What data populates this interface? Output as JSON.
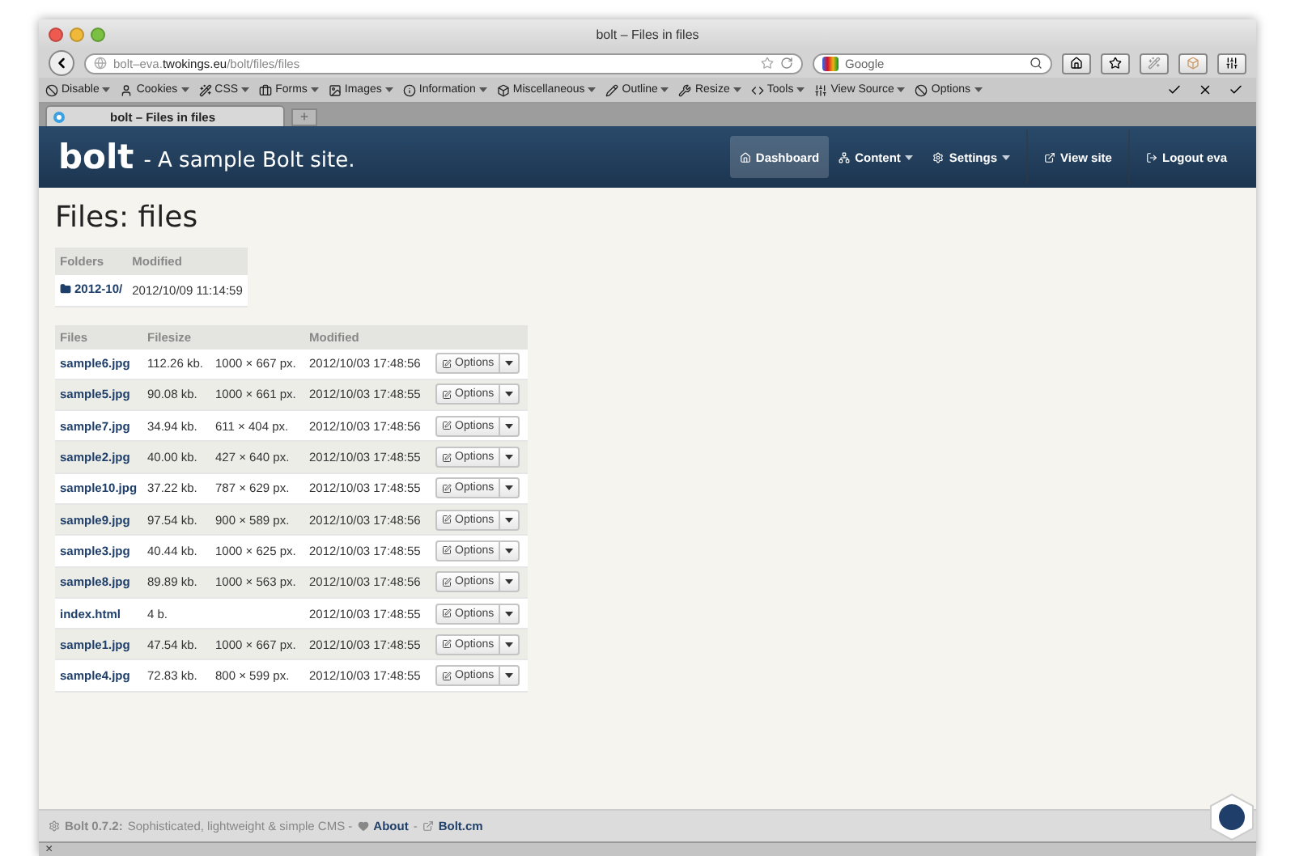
{
  "window": {
    "title": "bolt – Files in files"
  },
  "address_bar": {
    "url_prefix": "bolt–eva.",
    "url_domain": "twokings.eu",
    "url_path": "/bolt/files/files"
  },
  "search": {
    "engine": "Google"
  },
  "toolbar": [
    {
      "label": "Disable",
      "menu": true
    },
    {
      "label": "Cookies",
      "menu": true
    },
    {
      "label": "CSS",
      "menu": true
    },
    {
      "label": "Forms",
      "menu": true
    },
    {
      "label": "Images",
      "menu": true
    },
    {
      "label": "Information",
      "menu": true
    },
    {
      "label": "Miscellaneous",
      "menu": true
    },
    {
      "label": "Outline",
      "menu": true
    },
    {
      "label": "Resize",
      "menu": true
    },
    {
      "label": "Tools",
      "menu": true
    },
    {
      "label": "View Source",
      "menu": true
    },
    {
      "label": "Options",
      "menu": true
    }
  ],
  "tabs": [
    {
      "label": "bolt – Files in files",
      "selected": true
    }
  ],
  "new_tab": "+",
  "site": {
    "logo": "bolt",
    "tagline": "- A sample Bolt site."
  },
  "nav": [
    {
      "label": "Dashboard",
      "selected": true,
      "menu": false
    },
    {
      "label": "Content",
      "selected": false,
      "menu": true
    },
    {
      "label": "Settings",
      "selected": false,
      "menu": true
    },
    {
      "label": "View site",
      "selected": false,
      "menu": false
    },
    {
      "label": "Logout eva",
      "selected": false,
      "menu": false
    }
  ],
  "page_title": "Files: files",
  "folders": {
    "columns": [
      "Folders",
      "Modified"
    ],
    "rows": [
      {
        "name": "2012-10/",
        "modified": "2012/10/09 11:14:59"
      }
    ]
  },
  "files": {
    "columns": [
      "Files",
      "Filesize",
      "Modified"
    ],
    "rows": [
      {
        "name": "sample6.jpg",
        "size": "112.26 kb.",
        "dimensions": "1000 × 667 px.",
        "modified": "2012/10/03 17:48:56",
        "action": "Options"
      },
      {
        "name": "sample5.jpg",
        "size": "90.08 kb.",
        "dimensions": "1000 × 661 px.",
        "modified": "2012/10/03 17:48:55",
        "action": "Options"
      },
      {
        "name": "sample7.jpg",
        "size": "34.94 kb.",
        "dimensions": "611 × 404 px.",
        "modified": "2012/10/03 17:48:56",
        "action": "Options"
      },
      {
        "name": "sample2.jpg",
        "size": "40.00 kb.",
        "dimensions": "427 × 640 px.",
        "modified": "2012/10/03 17:48:55",
        "action": "Options"
      },
      {
        "name": "sample10.jpg",
        "size": "37.22 kb.",
        "dimensions": "787 × 629 px.",
        "modified": "2012/10/03 17:48:55",
        "action": "Options"
      },
      {
        "name": "sample9.jpg",
        "size": "97.54 kb.",
        "dimensions": "900 × 589 px.",
        "modified": "2012/10/03 17:48:56",
        "action": "Options"
      },
      {
        "name": "sample3.jpg",
        "size": "40.44 kb.",
        "dimensions": "1000 × 625 px.",
        "modified": "2012/10/03 17:48:55",
        "action": "Options"
      },
      {
        "name": "sample8.jpg",
        "size": "89.89 kb.",
        "dimensions": "1000 × 563 px.",
        "modified": "2012/10/03 17:48:56",
        "action": "Options"
      },
      {
        "name": "index.html",
        "size": "4 b.",
        "modified": "2012/10/03 17:48:55",
        "action": "Options"
      },
      {
        "name": "sample1.jpg",
        "size": "47.54 kb.",
        "dimensions": "1000 × 667 px.",
        "modified": "2012/10/03 17:48:55",
        "action": "Options"
      },
      {
        "name": "sample4.jpg",
        "size": "72.83 kb.",
        "dimensions": "800 × 599 px.",
        "modified": "2012/10/03 17:48:55",
        "action": "Options"
      }
    ]
  },
  "footer": {
    "version": "Bolt 0.7.2:",
    "tagline": "Sophisticated, lightweight & simple CMS -",
    "about": "About",
    "separator": "-",
    "site": "Bolt.cm"
  },
  "status_bar": {
    "close": "×"
  }
}
